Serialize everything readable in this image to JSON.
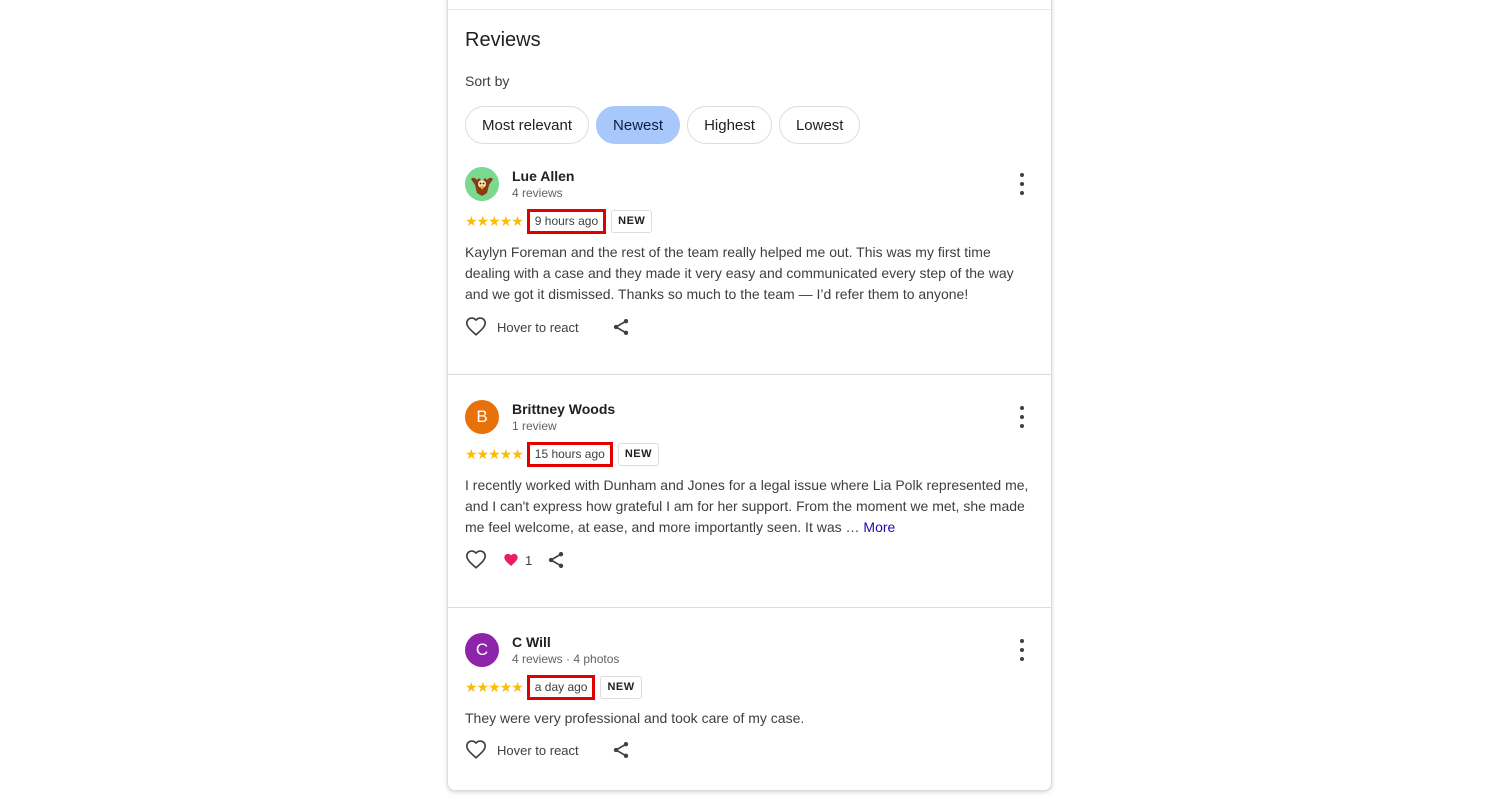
{
  "section": {
    "title": "Reviews",
    "sort_label": "Sort by",
    "chips": [
      {
        "label": "Most relevant"
      },
      {
        "label": "Newest"
      },
      {
        "label": "Highest"
      },
      {
        "label": "Lowest"
      }
    ],
    "active_chip": "Newest"
  },
  "reviews": [
    {
      "name": "Lue Allen",
      "meta": "4 reviews",
      "avatar_letter": "",
      "avatar_color": "#7bd88f",
      "rating": 5,
      "stars": "★★★★★",
      "time": "9 hours ago",
      "badge": "NEW",
      "text": "Kaylyn Foreman and the rest of the team really helped me out. This was my first time dealing with a case and they made it very easy and communicated every step of the way and we got it dismissed. Thanks so much to the team — I’d refer them to anyone!",
      "more": "",
      "react_label": "Hover to react",
      "reaction_count": ""
    },
    {
      "name": "Brittney Woods",
      "meta": "1 review",
      "avatar_letter": "B",
      "avatar_color": "#e8710a",
      "rating": 5,
      "stars": "★★★★★",
      "time": "15 hours ago",
      "badge": "NEW",
      "text": "I recently worked with Dunham and Jones for a legal issue where Lia Polk represented me, and I can't express how grateful I am for her support. From the moment we met, she made me feel welcome, at ease, and more importantly seen. It was …",
      "more": "More",
      "react_label": "",
      "reaction_count": "1"
    },
    {
      "name": "C Will",
      "meta": "4 reviews · 4 photos",
      "avatar_letter": "C",
      "avatar_color": "#8e24aa",
      "rating": 5,
      "stars": "★★★★★",
      "time": "a day ago",
      "badge": "NEW",
      "text": "They were very professional and took care of my case.",
      "more": "",
      "react_label": "Hover to react",
      "reaction_count": ""
    }
  ],
  "colors": {
    "star": "#fbbc04",
    "highlight_box": "#e00000",
    "active_chip_bg": "#a8c7fa",
    "link": "#1a0dab",
    "reaction_heart": "#e91e63"
  }
}
